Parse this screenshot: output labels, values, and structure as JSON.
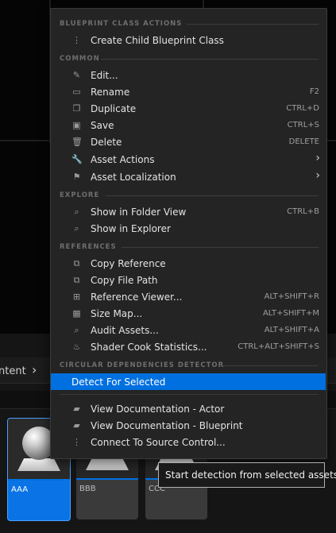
{
  "browser": {
    "breadcrumb": "ntent",
    "tiles": [
      {
        "label": "AAA",
        "selected": true
      },
      {
        "label": "BBB",
        "selected": false
      },
      {
        "label": "CCC",
        "selected": false
      }
    ]
  },
  "menu": {
    "sections": {
      "blueprint": "BLUEPRINT CLASS ACTIONS",
      "common": "COMMON",
      "explore": "EXPLORE",
      "references": "REFERENCES",
      "circular": "CIRCULAR DEPENDENCIES DETECTOR"
    },
    "items": {
      "create_child": {
        "label": "Create Child Blueprint Class",
        "icon": "hierarchy-icon"
      },
      "edit": {
        "label": "Edit...",
        "icon": "pencil-icon"
      },
      "rename": {
        "label": "Rename",
        "shortcut": "F2",
        "icon": "rename-icon"
      },
      "duplicate": {
        "label": "Duplicate",
        "shortcut": "CTRL+D",
        "icon": "duplicate-icon"
      },
      "save": {
        "label": "Save",
        "shortcut": "CTRL+S",
        "icon": "save-icon"
      },
      "delete": {
        "label": "Delete",
        "shortcut": "DELETE",
        "icon": "trash-icon"
      },
      "asset_actions": {
        "label": "Asset Actions",
        "icon": "wrench-icon"
      },
      "asset_localization": {
        "label": "Asset Localization",
        "icon": "flag-icon"
      },
      "show_folder": {
        "label": "Show in Folder View",
        "shortcut": "CTRL+B",
        "icon": "folder-search-icon"
      },
      "show_explorer": {
        "label": "Show in Explorer",
        "icon": "folder-search-icon"
      },
      "copy_ref": {
        "label": "Copy Reference",
        "icon": "copy-icon"
      },
      "copy_path": {
        "label": "Copy File Path",
        "icon": "copy-icon"
      },
      "ref_viewer": {
        "label": "Reference Viewer...",
        "shortcut": "ALT+SHIFT+R",
        "icon": "reference-viewer-icon"
      },
      "size_map": {
        "label": "Size Map...",
        "shortcut": "ALT+SHIFT+M",
        "icon": "size-map-icon"
      },
      "audit": {
        "label": "Audit Assets...",
        "shortcut": "ALT+SHIFT+A",
        "icon": "audit-icon"
      },
      "shader": {
        "label": "Shader Cook Statistics...",
        "shortcut": "CTRL+ALT+SHIFT+S",
        "icon": "shader-icon"
      },
      "detect": {
        "label": "Detect For Selected"
      },
      "doc_actor": {
        "label": "View Documentation - Actor",
        "icon": "book-icon"
      },
      "doc_blueprint": {
        "label": "View Documentation - Blueprint",
        "icon": "book-icon"
      },
      "source_control": {
        "label": "Connect To Source Control...",
        "icon": "source-control-icon"
      }
    }
  },
  "tooltip": "Start detection from selected assets",
  "colors": {
    "highlight": "#0070e0",
    "menu_bg": "#242424",
    "selected_tile": "#0a74e6"
  }
}
